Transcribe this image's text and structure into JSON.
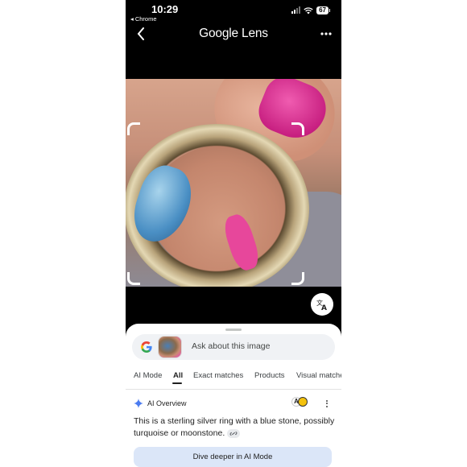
{
  "status_bar": {
    "time": "10:29",
    "back_app": "◂ Chrome",
    "battery": "67"
  },
  "header": {
    "title": "Google Lens"
  },
  "sheet": {
    "search_placeholder": "Ask about this image",
    "tabs": [
      "AI Mode",
      "All",
      "Exact matches",
      "Products",
      "Visual matches"
    ],
    "active_tab": "All",
    "ai_overview_label": "AI Overview",
    "ai_overview_text": "This is a sterling silver ring with a blue stone, possibly turquoise or moonstone.",
    "dive_deeper_label": "Dive deeper in AI Mode",
    "avatar_letter": "A"
  },
  "colors": {
    "accent_blue": "#1a73e8",
    "nail_pink": "#e7479b",
    "dive_button_bg": "#dbe6f8"
  }
}
